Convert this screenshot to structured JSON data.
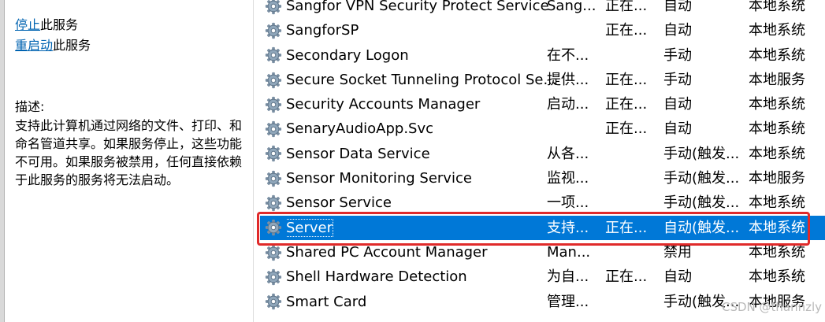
{
  "left_panel": {
    "stop_link": "停止",
    "stop_suffix": "此服务",
    "restart_link": "重启动",
    "restart_suffix": "此服务",
    "description_label": "描述:",
    "description_text": "支持此计算机通过网络的文件、打印、和命名管道共享。如果服务停止，这些功能不可用。如果服务被禁用，任何直接依赖于此服务的服务将无法启动。"
  },
  "services": [
    {
      "name": "Sangfor VPN Security Protect Service",
      "description": "Sang...",
      "status": "正在...",
      "startup": "自动",
      "logon": "本地系统"
    },
    {
      "name": "SangforSP",
      "description": "",
      "status": "正在...",
      "startup": "自动",
      "logon": "本地系统"
    },
    {
      "name": "Secondary Logon",
      "description": "在不...",
      "status": "",
      "startup": "手动",
      "logon": "本地系统"
    },
    {
      "name": "Secure Socket Tunneling Protocol Se...",
      "description": "提供...",
      "status": "正在...",
      "startup": "手动",
      "logon": "本地服务"
    },
    {
      "name": "Security Accounts Manager",
      "description": "启动...",
      "status": "正在...",
      "startup": "自动",
      "logon": "本地系统"
    },
    {
      "name": "SenaryAudioApp.Svc",
      "description": "",
      "status": "正在...",
      "startup": "自动",
      "logon": "本地系统"
    },
    {
      "name": "Sensor Data Service",
      "description": "从各...",
      "status": "",
      "startup": "手动(触发...",
      "logon": "本地系统"
    },
    {
      "name": "Sensor Monitoring Service",
      "description": "监视...",
      "status": "",
      "startup": "手动(触发...",
      "logon": "本地服务"
    },
    {
      "name": "Sensor Service",
      "description": "一项...",
      "status": "",
      "startup": "手动(触发...",
      "logon": "本地系统"
    },
    {
      "name": "Server",
      "description": "支持...",
      "status": "正在...",
      "startup": "自动(触发...",
      "logon": "本地系统"
    },
    {
      "name": "Shared PC Account Manager",
      "description": "Man...",
      "status": "",
      "startup": "禁用",
      "logon": "本地系统"
    },
    {
      "name": "Shell Hardware Detection",
      "description": "为自...",
      "status": "正在...",
      "startup": "自动",
      "logon": "本地系统"
    },
    {
      "name": "Smart Card",
      "description": "管理...",
      "status": "",
      "startup": "手动(触发...",
      "logon": "本地服务"
    }
  ],
  "selected_index": 9,
  "watermark": "CSDN @thannzly",
  "colors": {
    "selection": "#0078d7",
    "highlight_border": "#e02a2a",
    "link": "#0063b1"
  },
  "icon": "gear-icon"
}
